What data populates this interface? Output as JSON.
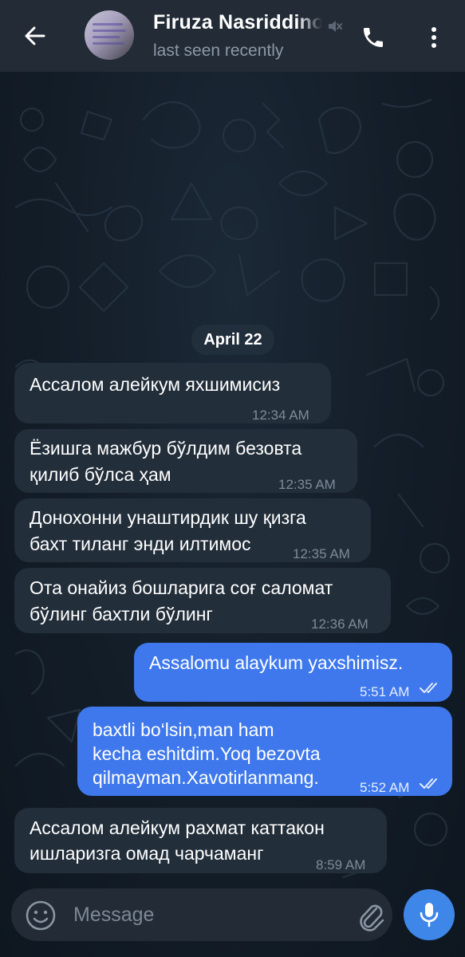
{
  "header": {
    "contact_name": "Firuza Nasriddinova",
    "status": "last seen recently",
    "icons": {
      "back": "arrow-left-icon",
      "muted": "muted-speaker-icon",
      "call": "phone-icon",
      "menu": "kebab-menu-icon"
    }
  },
  "date_separator": "April 22",
  "messages": [
    {
      "direction": "in",
      "lines": [
        "Ассалом алейкум яхшимисиз"
      ],
      "time": "12:34 AM"
    },
    {
      "direction": "in",
      "lines": [
        "Ёзишга мажбур бўлдим безовта",
        "қилиб бўлса ҳам"
      ],
      "time": "12:35 AM"
    },
    {
      "direction": "in",
      "lines": [
        "Донохонни унаштирдик шу қизга",
        "бахт тиланг энди илтимос"
      ],
      "time": "12:35 AM"
    },
    {
      "direction": "in",
      "lines": [
        "Ота онайиз бошларига соғ саломат",
        "бўлинг бахтли бўлинг"
      ],
      "time": "12:36 AM"
    },
    {
      "direction": "out",
      "lines": [
        "Assalomu alaykum yaxshimisz."
      ],
      "time": "5:51 AM",
      "read": true
    },
    {
      "direction": "out",
      "lines": [
        "baxtli bo‘lsin,man ham",
        "kecha eshitdim.Yoq bezovta",
        "qilmayman.Xavotirlanmang."
      ],
      "time": "5:52 AM",
      "read": true
    },
    {
      "direction": "in",
      "lines": [
        "Ассалом алейкум рахмат каттакон",
        "ишларизга омад чарчаманг"
      ],
      "time": "8:59 AM"
    }
  ],
  "composer": {
    "placeholder": "Message",
    "icons": {
      "emoji": "emoji-icon",
      "attach": "paperclip-icon",
      "mic": "microphone-icon"
    }
  },
  "colors": {
    "header_bg": "#222b36",
    "incoming_bubble": "#222e3a",
    "outgoing_bubble": "#3e78ec",
    "mic_button": "#3e86e8",
    "background": "#131d28"
  }
}
